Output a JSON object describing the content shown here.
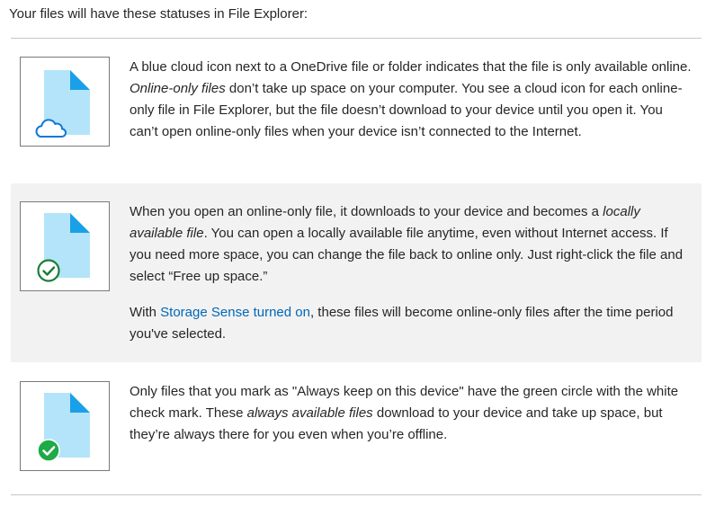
{
  "intro": "Your files will have these statuses in File Explorer:",
  "colors": {
    "file_body": "#b3e4f9",
    "file_fold": "#1aa0e8",
    "cloud_stroke": "#0f78d4",
    "check_outline": "#1a7f37",
    "check_filled": "#1eaa46",
    "link": "#0067b8"
  },
  "statuses": [
    {
      "icon": "online-only-file-icon",
      "badge": "cloud-icon",
      "parts": [
        [
          {
            "t": "A blue cloud icon next to a OneDrive file or folder indicates that the file is only available online. "
          },
          {
            "t": "Online-only files",
            "em": true
          },
          {
            "t": " don’t take up space on your computer. You see a cloud icon for each online-only file in File Explorer, but the file doesn’t download to your device until you open it. You can’t open online-only files when your device isn’t connected to the Internet."
          }
        ]
      ]
    },
    {
      "icon": "locally-available-file-icon",
      "badge": "green-check-outline-icon",
      "parts": [
        [
          {
            "t": "When you open an online-only file, it downloads to your device and becomes a "
          },
          {
            "t": "locally available file",
            "em": true
          },
          {
            "t": ". You can open a locally available file anytime, even without Internet access. If you need more space, you can change the file back to online only. Just right-click the file and select “Free up space.”"
          }
        ],
        [
          {
            "t": "With "
          },
          {
            "t": "Storage Sense turned on",
            "link": true
          },
          {
            "t": ", these files will become online-only files after the time period you've selected."
          }
        ]
      ]
    },
    {
      "icon": "always-available-file-icon",
      "badge": "green-check-filled-icon",
      "parts": [
        [
          {
            "t": "Only files that you mark as \"Always keep on this device\" have the green circle with the white check mark. These "
          },
          {
            "t": "always available files",
            "em": true
          },
          {
            "t": " download to your device and take up space, but they’re always there for you even when you’re offline."
          }
        ]
      ]
    }
  ]
}
